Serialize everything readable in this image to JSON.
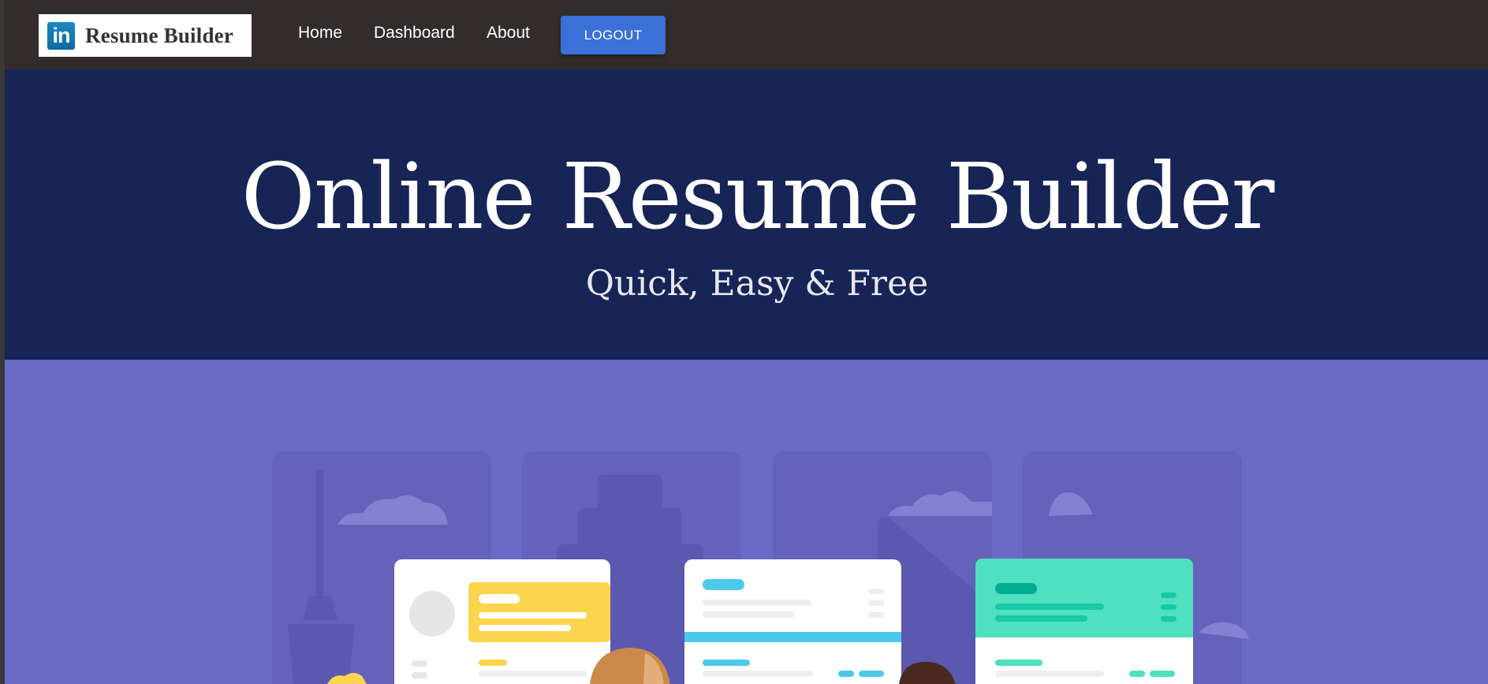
{
  "nav": {
    "logo_badge": "in",
    "logo_text": "Resume Builder",
    "links": [
      "Home",
      "Dashboard",
      "About"
    ],
    "logout_label": "LOGOUT"
  },
  "hero": {
    "title": "Online Resume Builder",
    "subtitle": "Quick, Easy & Free"
  },
  "colors": {
    "navbar": "#322d2c",
    "hero_bg": "#172456",
    "illustration_bg": "#6b6ac4",
    "logout_button": "#3a70d8",
    "accent_yellow": "#fbd54d",
    "accent_blue": "#4cc9ea",
    "accent_teal": "#4fe0bf"
  },
  "icons": [
    "linkedin-icon"
  ]
}
